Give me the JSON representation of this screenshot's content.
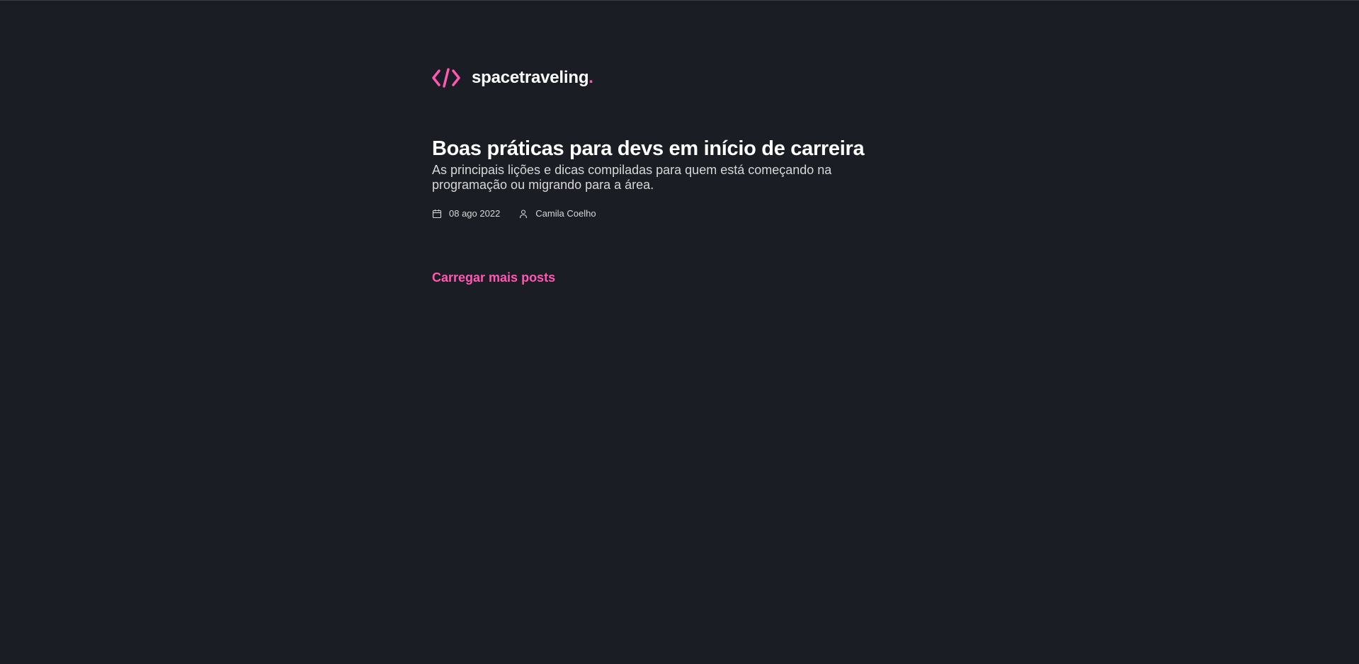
{
  "header": {
    "logo_text": "spacetraveling",
    "logo_dot": ".",
    "logo_icon": "code-brackets-icon"
  },
  "posts": [
    {
      "title": "Boas práticas para devs em início de carreira",
      "subtitle": "As principais lições e dicas compiladas para quem está começando na programação ou migrando para a área.",
      "date": "08 ago 2022",
      "author": "Camila Coelho",
      "date_icon": "calendar-icon",
      "author_icon": "user-icon"
    }
  ],
  "load_more_label": "Carregar mais posts",
  "colors": {
    "background": "#1a1d23",
    "accent": "#ff57b2",
    "heading": "#ffffff",
    "body_text": "#d7d7d7"
  }
}
